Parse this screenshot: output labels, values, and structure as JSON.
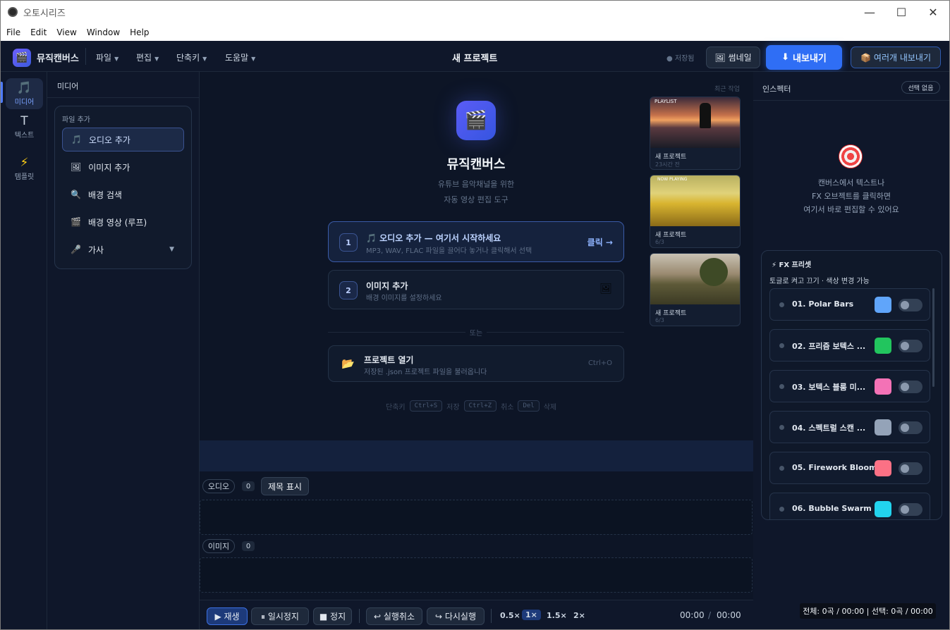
{
  "window": {
    "title": "오토시리즈",
    "controls": {
      "minimize": "—",
      "maximize": "☐",
      "close": "✕"
    }
  },
  "menubar": [
    "File",
    "Edit",
    "View",
    "Window",
    "Help"
  ],
  "header": {
    "brand": "뮤직캔버스",
    "menus": [
      "파일",
      "편집",
      "단축키",
      "도움말"
    ],
    "project_title": "새 프로젝트",
    "saved_status": "● 저장됨",
    "thumbnail_label": "썸네일",
    "export_label": "내보내기",
    "multi_export_label": "여러개 내보내기"
  },
  "rail": [
    {
      "label": "미디어",
      "icon": "music-note-icon",
      "glyph": "🎵",
      "active": true
    },
    {
      "label": "텍스트",
      "icon": "text-icon",
      "glyph": "T",
      "active": false
    },
    {
      "label": "템플릿",
      "icon": "lightning-icon",
      "glyph": "⚡",
      "active": false
    }
  ],
  "media_panel": {
    "title": "미디어",
    "group_label": "파일 추가",
    "items": [
      {
        "label": "오디오 추가",
        "icon": "music-note-icon",
        "glyph": "🎵",
        "active": true
      },
      {
        "label": "이미지 추가",
        "icon": "image-icon",
        "glyph": "🖼",
        "active": false
      },
      {
        "label": "배경 검색",
        "icon": "search-icon",
        "glyph": "🔍",
        "active": false
      },
      {
        "label": "배경 영상 (루프)",
        "icon": "film-icon",
        "glyph": "🎬",
        "active": false
      },
      {
        "label": "가사",
        "icon": "microphone-icon",
        "glyph": "🎤",
        "active": false,
        "caret": "▼"
      }
    ]
  },
  "hero": {
    "title": "뮤직캔버스",
    "subtitle_line1": "유튜브 음악채널을 위한",
    "subtitle_line2": "자동 영상 편집 도구"
  },
  "steps": [
    {
      "num": "1",
      "title": "🎵 오디오 추가 — 여기서 시작하세요",
      "sub": "MP3, WAV, FLAC 파일을 끌어다 놓거나 클릭해서 선택",
      "action": "클릭 →"
    },
    {
      "num": "2",
      "title": "이미지 추가",
      "sub": "배경 이미지를 설정하세요",
      "icon": "image-icon"
    }
  ],
  "divider_label": "또는",
  "open_project": {
    "title": "프로젝트 열기",
    "sub": "저장된 .json 프로젝트 파일을 불러옵니다",
    "shortcut": "Ctrl+O"
  },
  "shortcuts": {
    "label": "단축키",
    "items": [
      {
        "key": "Ctrl+S",
        "action": "저장"
      },
      {
        "key": "Ctrl+Z",
        "action": "취소"
      },
      {
        "key": "Del",
        "action": "삭제"
      }
    ]
  },
  "recent": {
    "label": "최근 작업",
    "items": [
      {
        "name": "새 프로젝트",
        "time": "23시간 전",
        "overlay": "PLAYLIST"
      },
      {
        "name": "새 프로젝트",
        "time": "6/3",
        "overlay": "NOW PLAYING"
      },
      {
        "name": "새 프로젝트",
        "time": "6/3",
        "overlay": ""
      }
    ]
  },
  "timeline": {
    "audio_label": "오디오",
    "audio_count": "0",
    "show_title_label": "제목 표시",
    "image_label": "이미지",
    "image_count": "0"
  },
  "controls": {
    "play": "▶ 재생",
    "pause": "⏸ 일시정지",
    "stop": "■ 정지",
    "undo": "↩ 실행취소",
    "redo": "↪ 다시실행",
    "speeds": [
      "0.5×",
      "1×",
      "1.5×",
      "2×"
    ],
    "active_speed": "1×",
    "current_time": "00:00",
    "time_sep": "/",
    "total_time": "00:00"
  },
  "inspector": {
    "title": "인스펙터",
    "selection_badge": "선택 없음",
    "hint_line1": "캔버스에서 텍스트나",
    "hint_line2": "FX 오브젝트를 클릭하면",
    "hint_line3": "여기서 바로 편집할 수 있어요",
    "fx_title": "⚡ FX 프리셋",
    "fx_sub": "토글로 켜고 끄기 · 색상 변경 가능",
    "fx_items": [
      {
        "name": "01. Polar Bars",
        "color": "#60a5fa",
        "enabled": false
      },
      {
        "name": "02. 프리즘 보텍스 ...",
        "color": "#22c55e",
        "enabled": false
      },
      {
        "name": "03. 보텍스 블룸 미...",
        "color": "#f472b6",
        "enabled": false
      },
      {
        "name": "04. 스펙트럴 스캔 ...",
        "color": "#94a3b8",
        "enabled": false
      },
      {
        "name": "05. Firework Bloom",
        "color": "#fb7185",
        "enabled": false
      },
      {
        "name": "06. Bubble Swarm",
        "color": "#22d3ee",
        "enabled": false
      }
    ]
  },
  "status_bar": "전체: 0곡 / 00:00 | 선택: 0곡 / 00:00"
}
